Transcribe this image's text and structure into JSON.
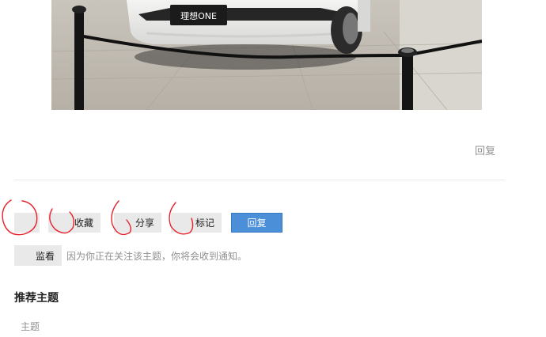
{
  "post": {
    "image_plate_text": "理想ONE",
    "reply_link": "回复"
  },
  "actions": {
    "bookmark": "收藏",
    "share": "分享",
    "flag": "标记",
    "reply": "回复"
  },
  "notifications": {
    "button": "监看",
    "reason": "因为你正在关注该主题，你将会收到通知。"
  },
  "suggested": {
    "title": "推荐主题",
    "column_topic": "主题"
  },
  "colors": {
    "reply_button": "#4b8fd8",
    "annotation_ink": "#e8202a",
    "button_gray": "#e9e9e9"
  }
}
